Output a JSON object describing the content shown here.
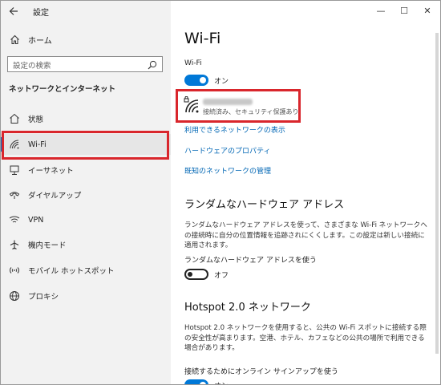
{
  "app_title": "設定",
  "window_controls": {
    "minimize": "—",
    "maximize": "☐",
    "close": "✕"
  },
  "sidebar": {
    "home_label": "ホーム",
    "search_placeholder": "設定の検索",
    "section_title": "ネットワークとインターネット",
    "items": [
      {
        "label": "状態",
        "icon": "home-status-icon"
      },
      {
        "label": "Wi-Fi",
        "icon": "wifi-icon",
        "selected": true
      },
      {
        "label": "イーサネット",
        "icon": "ethernet-icon"
      },
      {
        "label": "ダイヤルアップ",
        "icon": "dialup-icon"
      },
      {
        "label": "VPN",
        "icon": "vpn-icon"
      },
      {
        "label": "機内モード",
        "icon": "airplane-icon"
      },
      {
        "label": "モバイル ホットスポット",
        "icon": "hotspot-icon"
      },
      {
        "label": "プロキシ",
        "icon": "globe-icon"
      }
    ]
  },
  "main": {
    "title": "Wi-Fi",
    "wifi_label": "Wi-Fi",
    "wifi_toggle": {
      "state": "on",
      "label": "オン"
    },
    "network": {
      "status": "接続済み、セキュリティ保護あり"
    },
    "links": [
      "利用できるネットワークの表示",
      "ハードウェアのプロパティ",
      "既知のネットワークの管理"
    ],
    "random_hw": {
      "heading": "ランダムなハードウェア アドレス",
      "description": "ランダムなハードウェア アドレスを使って、さまざまな Wi-Fi ネットワークへの接続時に自分の位置情報を追跡されにくくします。この設定は新しい接続に適用されます。",
      "toggle_label": "ランダムなハードウェア アドレスを使う",
      "toggle": {
        "state": "off",
        "label": "オフ"
      }
    },
    "hotspot": {
      "heading": "Hotspot 2.0 ネットワーク",
      "description": "Hotspot 2.0 ネットワークを使用すると、公共の Wi-Fi スポットに接続する際の安全性が高まります。空港、ホテル、カフェなどの公共の場所で利用できる場合があります。",
      "toggle_label": "接続するためにオンライン サインアップを使う",
      "toggle": {
        "state": "on",
        "label": "オン"
      }
    }
  },
  "colors": {
    "accent": "#0078d7",
    "highlight_box": "#d9262c",
    "link": "#0066b4",
    "sidebar_bg": "#f2f2f2"
  }
}
